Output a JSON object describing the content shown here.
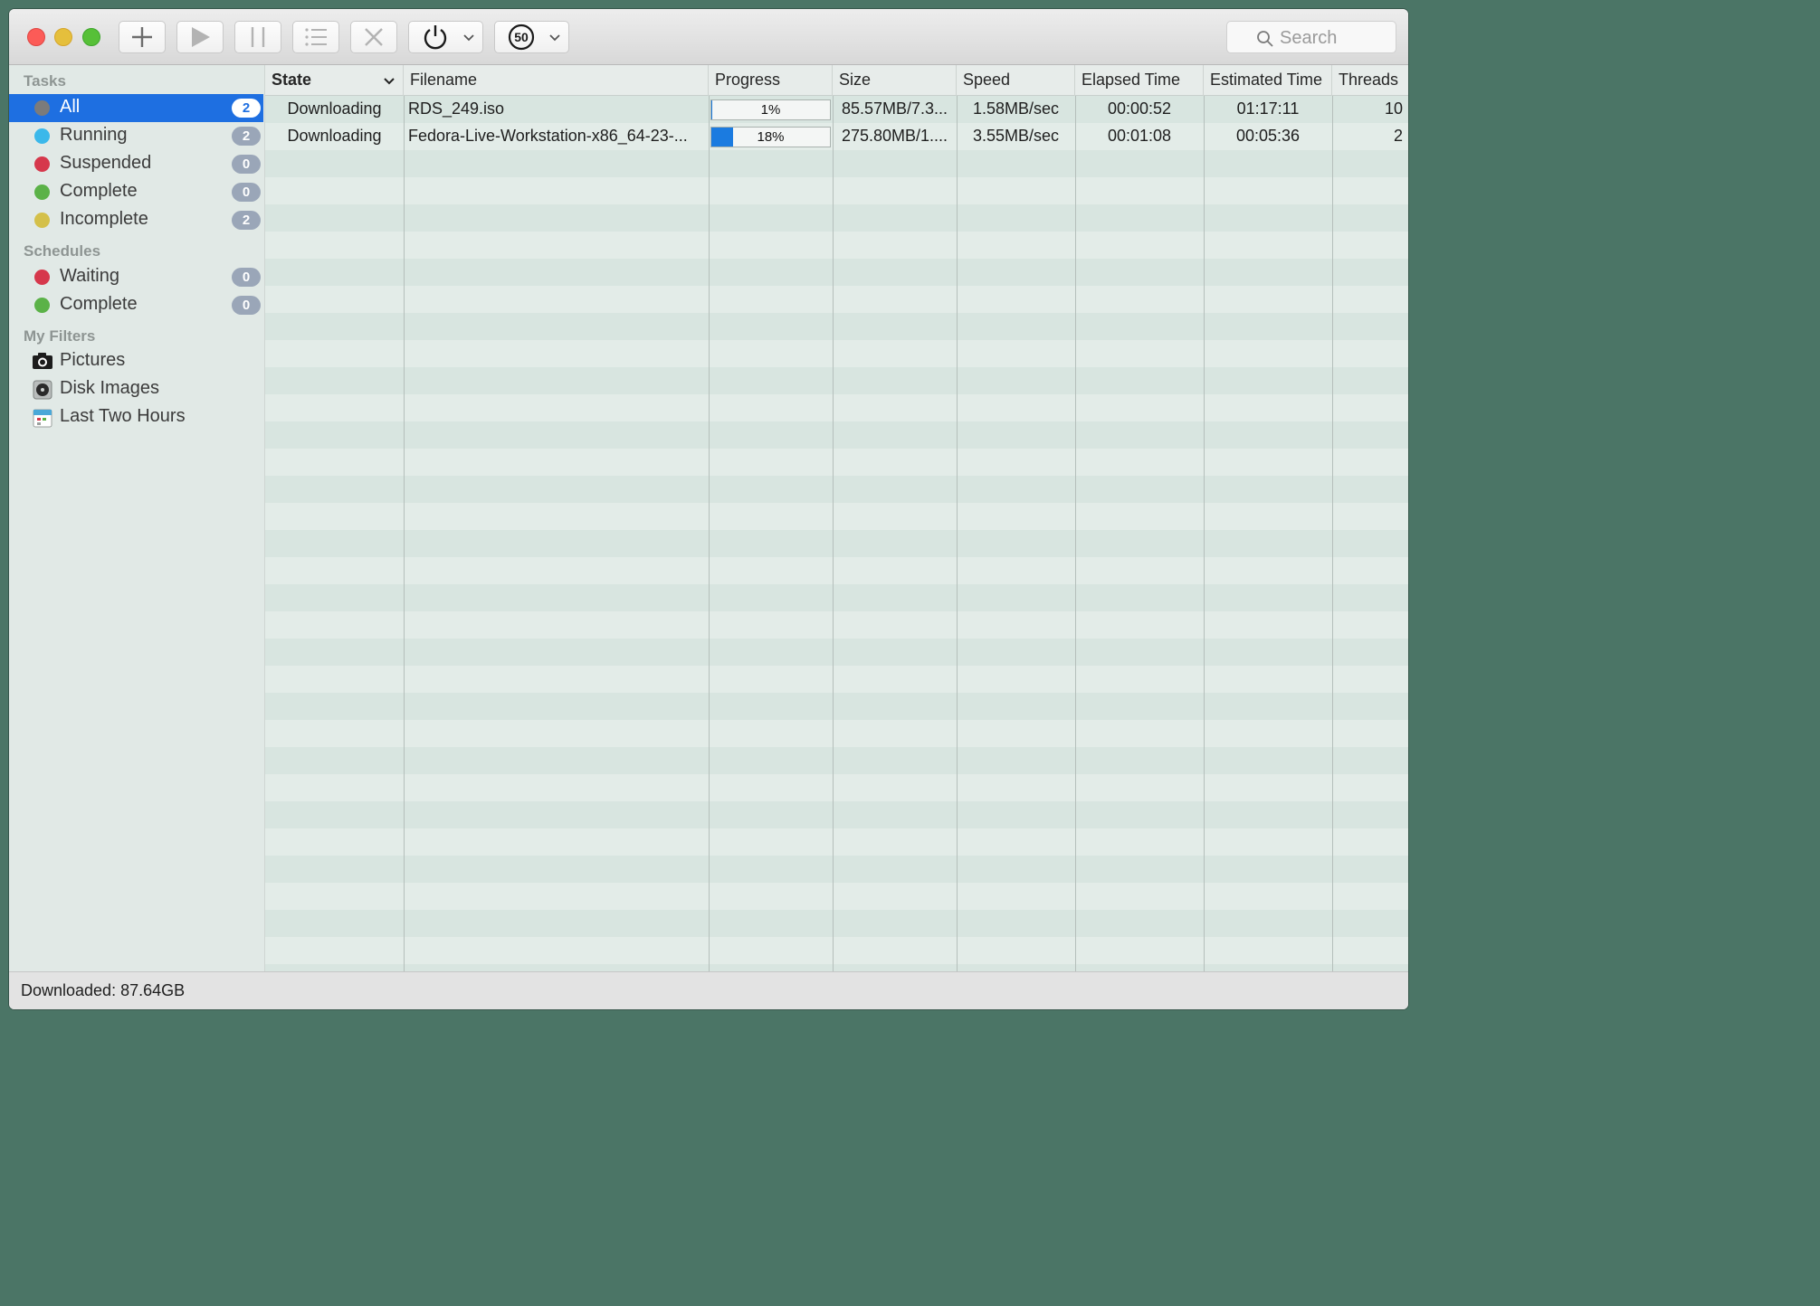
{
  "toolbar": {
    "buttons": [
      {
        "name": "add-button",
        "icon": "plus-icon"
      },
      {
        "name": "resume-button",
        "icon": "play-icon"
      },
      {
        "name": "pause-button",
        "icon": "pause-icon"
      },
      {
        "name": "list-button",
        "icon": "list-icon"
      },
      {
        "name": "remove-button",
        "icon": "close-icon"
      },
      {
        "name": "power-button",
        "icon": "power-icon"
      },
      {
        "name": "speed-limit-button",
        "icon": "speed-limit-icon"
      }
    ],
    "speed_limit_value": "50",
    "search_placeholder": "Search"
  },
  "sidebar": {
    "tasks_heading": "Tasks",
    "tasks": [
      {
        "label": "All",
        "count": "2",
        "color": "#7b7b7b",
        "selected": true
      },
      {
        "label": "Running",
        "count": "2",
        "color": "#3bb8ea"
      },
      {
        "label": "Suspended",
        "count": "0",
        "color": "#d6384c"
      },
      {
        "label": "Complete",
        "count": "0",
        "color": "#5bb248"
      },
      {
        "label": "Incomplete",
        "count": "2",
        "color": "#d4c04a"
      }
    ],
    "schedules_heading": "Schedules",
    "schedules": [
      {
        "label": "Waiting",
        "count": "0",
        "color": "#d6384c"
      },
      {
        "label": "Complete",
        "count": "0",
        "color": "#5bb248"
      }
    ],
    "filters_heading": "My Filters",
    "filters": [
      {
        "label": "Pictures",
        "icon": "camera-icon"
      },
      {
        "label": "Disk Images",
        "icon": "disk-image-icon"
      },
      {
        "label": "Last Two Hours",
        "icon": "calendar-icon"
      }
    ]
  },
  "table": {
    "columns": [
      "State",
      "Filename",
      "Progress",
      "Size",
      "Speed",
      "Elapsed Time",
      "Estimated Time",
      "Threads"
    ],
    "sorted_column": "State",
    "rows": [
      {
        "state": "Downloading",
        "filename": "RDS_249.iso",
        "progress": 0.01,
        "progress_label": "1%",
        "size": "85.57MB/7.3...",
        "speed": "1.58MB/sec",
        "elapsed": "00:00:52",
        "estimated": "01:17:11",
        "threads": "10"
      },
      {
        "state": "Downloading",
        "filename": "Fedora-Live-Workstation-x86_64-23-...",
        "progress": 0.18,
        "progress_label": "18%",
        "size": "275.80MB/1....",
        "speed": "3.55MB/sec",
        "elapsed": "00:01:08",
        "estimated": "00:05:36",
        "threads": "2"
      }
    ]
  },
  "status": {
    "downloaded": "Downloaded: 87.64GB"
  },
  "colors": {
    "selection": "#1e6fe1",
    "progress_fill": "#1b7be0"
  }
}
